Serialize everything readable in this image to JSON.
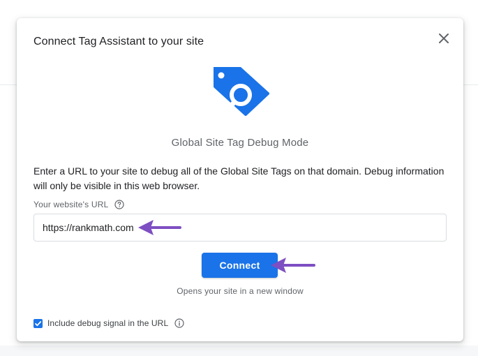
{
  "dialog": {
    "title": "Connect Tag Assistant to your site",
    "close_icon": "close-icon",
    "hero_icon": "tag-search-icon",
    "subtitle": "Global Site Tag Debug Mode",
    "description": "Enter a URL to your site to debug all of the Global Site Tags on that domain. Debug information will only be visible in this web browser.",
    "url_label": "Your website's URL",
    "url_help_icon": "help-circle-icon",
    "url_value": "https://rankmath.com",
    "connect_label": "Connect",
    "connect_hint": "Opens your site in a new window",
    "debug_checkbox_checked": true,
    "debug_checkbox_label": "Include debug signal in the URL",
    "debug_info_icon": "info-icon"
  },
  "colors": {
    "accent": "#1a73e8",
    "annotation_arrow": "#7e4fc2"
  }
}
